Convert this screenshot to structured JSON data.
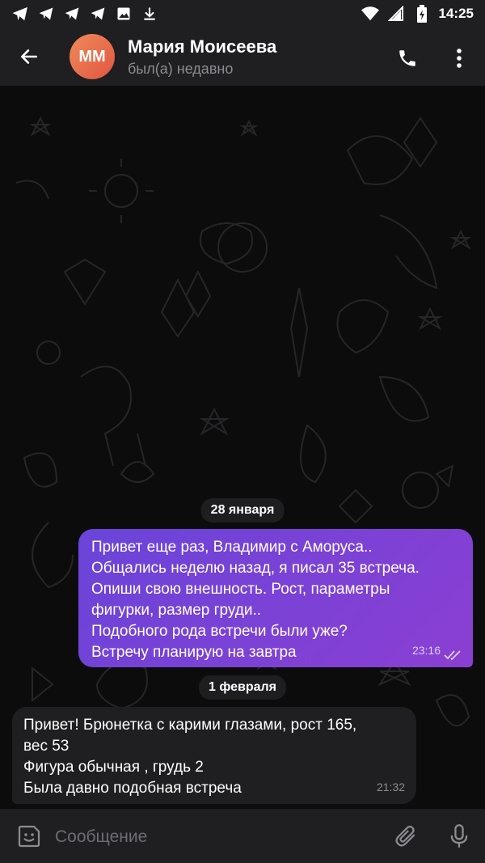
{
  "status_bar": {
    "time": "14:25",
    "icons": [
      "telegram-icon",
      "telegram-icon",
      "telegram-icon",
      "telegram-icon",
      "image-icon",
      "download-icon",
      "wifi-icon",
      "sim-icon",
      "battery-icon"
    ]
  },
  "header": {
    "avatar_initials": "ММ",
    "title": "Мария Моисеева",
    "subtitle": "был(а) недавно"
  },
  "messages": [
    {
      "type": "date",
      "text": "28 января"
    },
    {
      "type": "outgoing",
      "lines": [
        "Привет еще раз, Владимир с Аморуса..",
        "Общались неделю назад, я писал 35 встреча.",
        "Опиши свою внешность. Рост, параметры",
        "фигурки, размер груди..",
        "Подобного рода встречи были уже?",
        "Встречу планирую на завтра"
      ],
      "time": "23:16",
      "read": true
    },
    {
      "type": "date",
      "text": "1 февраля"
    },
    {
      "type": "incoming",
      "lines": [
        "Привет! Брюнетка с карими глазами, рост 165,",
        "вес 53",
        "Фигура обычная , грудь 2",
        "Была давно подобная встреча"
      ],
      "time": "21:32"
    }
  ],
  "composer": {
    "placeholder": "Сообщение"
  },
  "colors": {
    "accent": "#7b42d6",
    "bar": "#1f1f21",
    "chat_bg": "#0c0c0d"
  }
}
